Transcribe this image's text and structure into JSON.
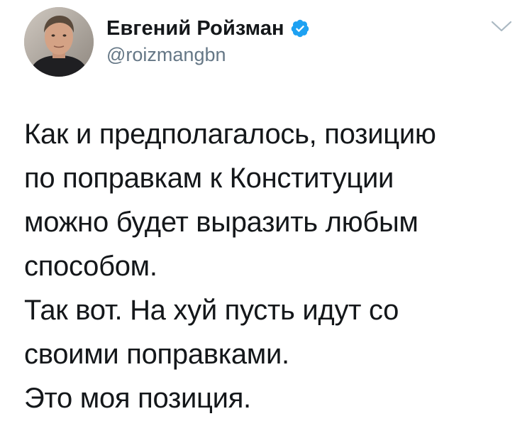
{
  "tweet": {
    "author": {
      "display_name": "Евгений Ройзман",
      "handle": "@roizmangbn",
      "verified": true,
      "avatar_icon": "profile-photo"
    },
    "menu_icon": "chevron-down-icon",
    "text": "Как и предполагалось, позицию\nпо поправкам к Конституции\nможно будет выразить любым\nспособом.\nТак вот. На хуй пусть идут со\nсвоими поправками.\nЭто моя позиция."
  },
  "colors": {
    "verified_badge": "#1da1f2",
    "text_primary": "#14171a",
    "text_secondary": "#657786"
  }
}
